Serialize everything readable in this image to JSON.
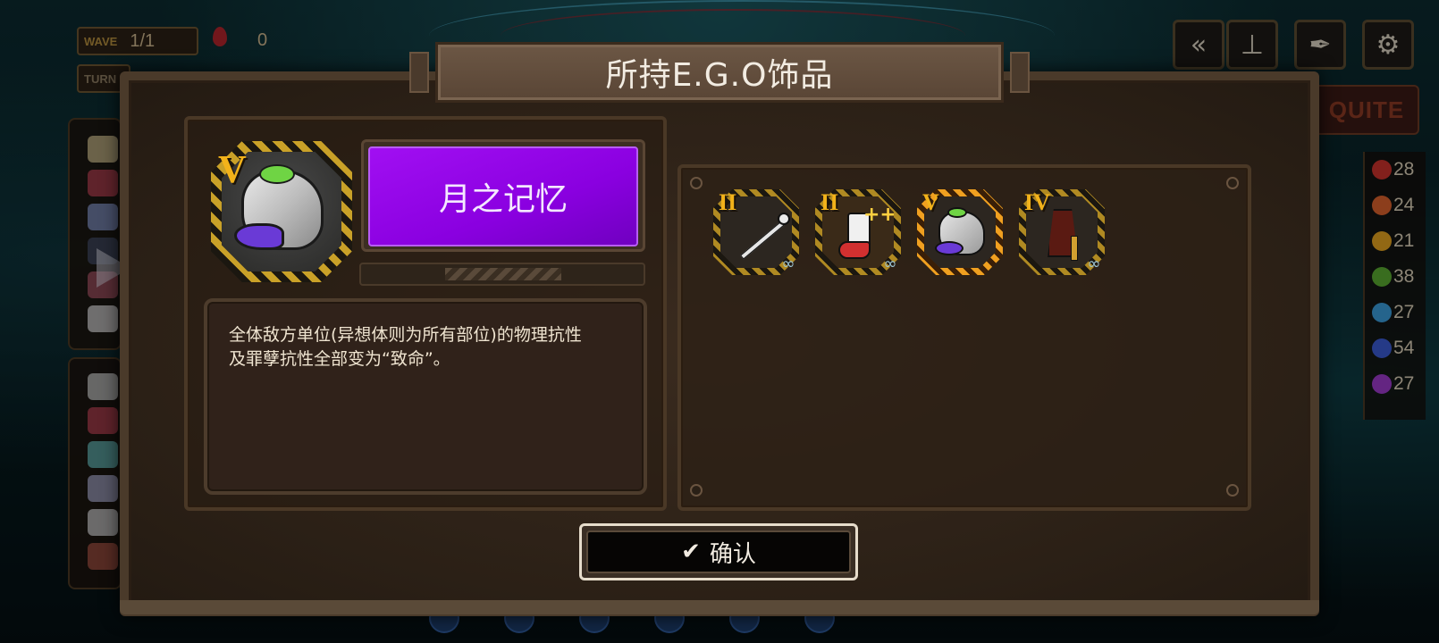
{
  "hud": {
    "wave_label": "WAVE",
    "wave_value": "1/1",
    "turn_label": "TURN",
    "counter_value": "0"
  },
  "top_right": {
    "rewind_icon": "double-chevron-left-icon",
    "speed_icon": "lever-icon",
    "auto_icon": "quill-icon",
    "settings_icon": "gear-icon",
    "exit_label": "QUITE"
  },
  "resources": [
    {
      "color": "#c8322c",
      "value": "28"
    },
    {
      "color": "#d8602c",
      "value": "24"
    },
    {
      "color": "#e0a020",
      "value": "21"
    },
    {
      "color": "#58a830",
      "value": "38"
    },
    {
      "color": "#3a9ad8",
      "value": "27"
    },
    {
      "color": "#3a5ad0",
      "value": "54"
    },
    {
      "color": "#9a3ac8",
      "value": "27"
    }
  ],
  "modal": {
    "title": "所持E.G.O饰品",
    "selected": {
      "rank": "V",
      "name": "月之记忆",
      "name_bg_color": "#8a00e0",
      "description_line1": "全体敌方单位(异想体则为所有部位)的物理抗性",
      "description_line2": "及罪孽抗性全部变为“致命”。"
    },
    "items": [
      {
        "rank": "II",
        "art": "staff",
        "selected": false
      },
      {
        "rank": "II",
        "art": "sock",
        "selected": false
      },
      {
        "rank": "V",
        "art": "moon-rock",
        "selected": true
      },
      {
        "rank": "IV",
        "art": "robe",
        "selected": false
      }
    ],
    "confirm_label": "确认"
  },
  "colors": {
    "accent_gold": "#f2b21a",
    "modal_bg": "#2b2016",
    "selected_orange": "#f0a020"
  }
}
